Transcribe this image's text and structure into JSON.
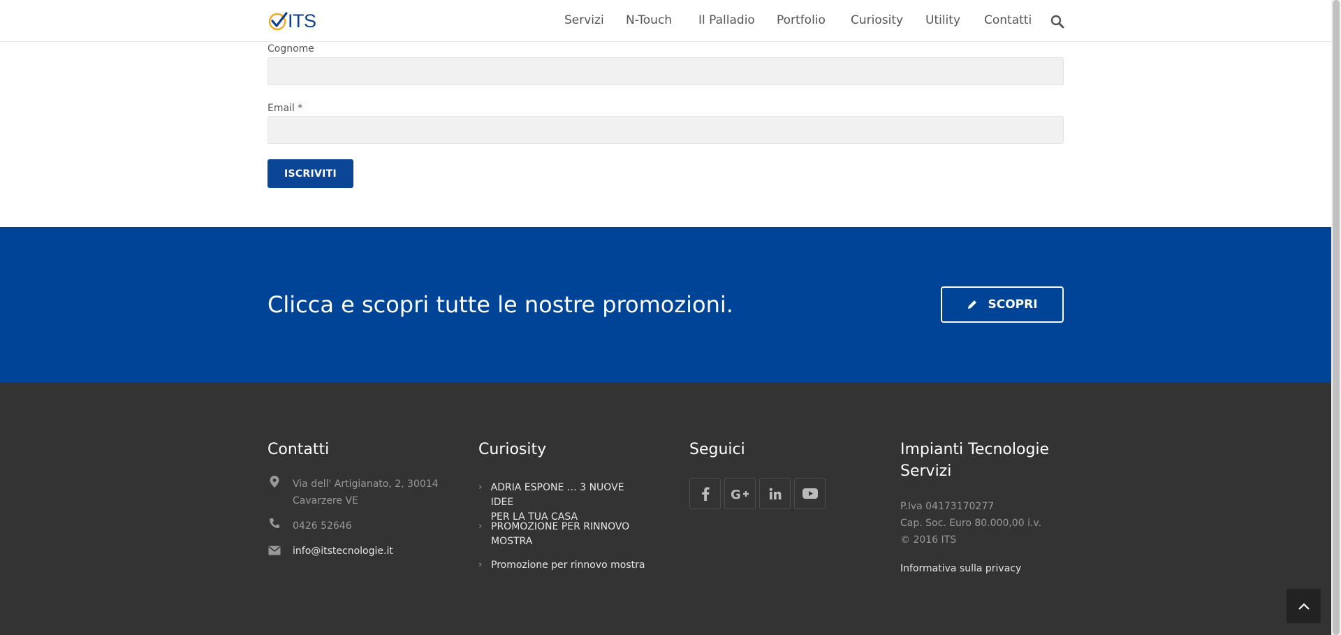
{
  "header": {
    "logo_text": "ITS",
    "nav": [
      "Servizi",
      "N-Touch",
      "Il Palladio",
      "Portfolio",
      "Curiosity",
      "Utility",
      "Contatti"
    ],
    "search_icon": "search-icon"
  },
  "form": {
    "cognome_label": "Cognome",
    "cognome_value": "",
    "email_label": "Email *",
    "email_value": "",
    "submit_label": "ISCRIVITI"
  },
  "promo": {
    "text": "Clicca e scopri tutte le nostre promozioni.",
    "button_label": "SCOPRI",
    "button_icon": "pencil-icon",
    "background": "#004497"
  },
  "footer": {
    "contatti": {
      "title": "Contatti",
      "address_line1": "Via dell' Artigianato, 2, 30014",
      "address_line2": "Cavarzere VE",
      "phone": "0426 52646",
      "email": "info@itstecnologie.it"
    },
    "curiosity": {
      "title": "Curiosity",
      "items": [
        {
          "line1": "ADRIA ESPONE … 3 NUOVE IDEE",
          "line2": "PER LA TUA CASA"
        },
        {
          "line1": "PROMOZIONE PER RINNOVO",
          "line2": "MOSTRA"
        },
        {
          "line1": "Promozione per rinnovo mostra",
          "line2": ""
        }
      ]
    },
    "seguici": {
      "title": "Seguici",
      "icons": [
        "facebook-icon",
        "google-plus-icon",
        "linkedin-icon",
        "youtube-icon"
      ]
    },
    "company": {
      "title_line1": "Impianti Tecnologie",
      "title_line2": "Servizi",
      "piva": "P.Iva 04173170277",
      "capitale": "Cap. Soc. Euro 80.000,00 i.v.",
      "copyright": "© 2016 ITS",
      "privacy": "Informativa sulla privacy"
    },
    "background": "#333333"
  },
  "colors": {
    "brand_blue": "#0b4596",
    "logo_orange": "#f4a81d"
  }
}
